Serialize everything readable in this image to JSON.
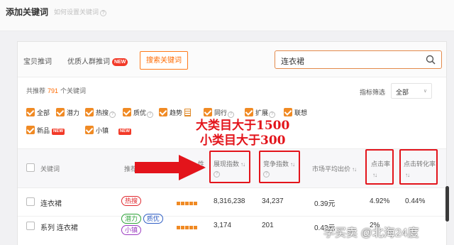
{
  "header": {
    "title": "添加关键词",
    "help_text": "如何设置关键词",
    "help_icon": "?"
  },
  "tabs": [
    {
      "label": "宝贝推词"
    },
    {
      "label": "优质人群推词",
      "badge": "NEW"
    },
    {
      "label": "搜索关键词",
      "active": true
    }
  ],
  "search": {
    "value": "连衣裙",
    "icon": "search-icon"
  },
  "summary": {
    "prefix": "共推荐",
    "count": "791",
    "suffix": "个关键词"
  },
  "filter": {
    "label": "指标筛选",
    "value": "全部",
    "chevron": "∨"
  },
  "checkboxes": {
    "all": "全部",
    "potential": "潜力",
    "hot": "热搜",
    "quality": "质优",
    "trend": "趋势",
    "peer": "同行",
    "expand": "扩展",
    "assoc": "联想",
    "new_product": "新品",
    "small_town": "小镇",
    "new_badge": "NEW",
    "q": "?"
  },
  "table": {
    "headers": {
      "keyword": "关键词",
      "recommend": "推荐",
      "attr": "性",
      "impression": "展现指数",
      "competition": "竞争指数",
      "avg_bid": "市场平均出价",
      "ctr": "点击率",
      "cvr": "点击转化率",
      "sort_icon": "↑↓",
      "q": "?"
    },
    "rows": [
      {
        "keyword": "连衣裙",
        "tags": [
          "热搜"
        ],
        "impression": "8,316,238",
        "competition": "34,237",
        "avg_bid": "0.39元",
        "ctr": "4.92%",
        "cvr": "0.44%"
      },
      {
        "keyword": "系列 连衣裙",
        "tags": [
          "潜力",
          "质优",
          "小镇"
        ],
        "impression": "3,174",
        "competition": "201",
        "avg_bid": "0.42元",
        "ctr": "2%",
        "cvr": ""
      }
    ]
  },
  "annotation": {
    "line1": "大类目大于1500",
    "line2": "小类目大于300",
    "arrow_color": "#e3141b"
  },
  "watermark": "学买卖 @北海24度",
  "colors": {
    "accent": "#ff6a00",
    "checkbox": "#f08a24",
    "annotation": "#e3141b"
  }
}
